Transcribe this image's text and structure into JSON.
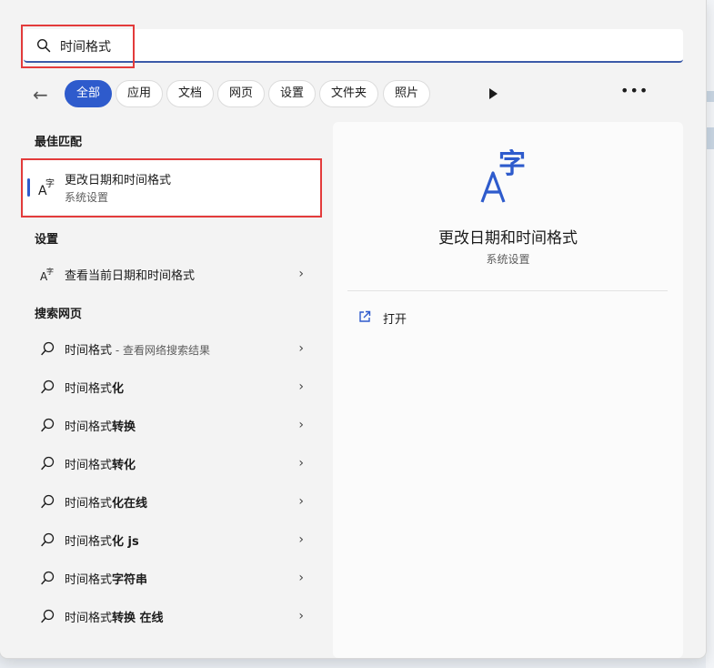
{
  "search": {
    "query": "时间格式"
  },
  "filters": {
    "chips": [
      "全部",
      "应用",
      "文档",
      "网页",
      "设置",
      "文件夹",
      "照片"
    ],
    "active": "全部"
  },
  "best_match": {
    "title": "最佳匹配",
    "item": {
      "name": "更改日期和时间格式",
      "type": "系统设置"
    }
  },
  "settings": {
    "title": "设置",
    "items": [
      {
        "label": "查看当前日期和时间格式"
      }
    ]
  },
  "web": {
    "title": "搜索网页",
    "items": [
      {
        "prefix": "时间格式",
        "suffix": "",
        "note": " - 查看网络搜索结果"
      },
      {
        "prefix": "时间格式",
        "suffix": "化",
        "note": ""
      },
      {
        "prefix": "时间格式",
        "suffix": "转换",
        "note": ""
      },
      {
        "prefix": "时间格式",
        "suffix": "转化",
        "note": ""
      },
      {
        "prefix": "时间格式",
        "suffix": "化在线",
        "note": ""
      },
      {
        "prefix": "时间格式",
        "suffix": "化 js",
        "note": ""
      },
      {
        "prefix": "时间格式",
        "suffix": "字符串",
        "note": ""
      },
      {
        "prefix": "时间格式",
        "suffix": "转换 在线",
        "note": ""
      }
    ]
  },
  "detail": {
    "title": "更改日期和时间格式",
    "subtitle": "系统设置",
    "actions": [
      {
        "label": "打开",
        "icon": "open-external-icon"
      }
    ]
  },
  "colors": {
    "accent": "#2e5bcc",
    "highlight_box": "#e33b3b"
  }
}
